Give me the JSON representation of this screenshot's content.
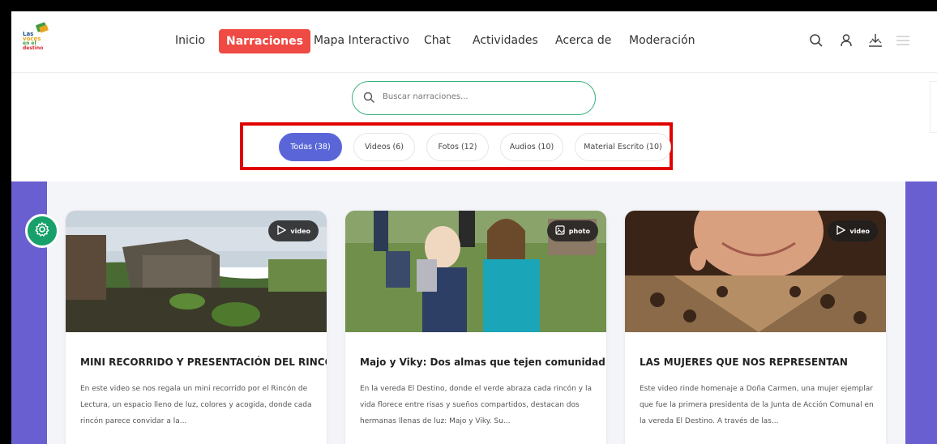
{
  "brand": {
    "logo_lines": [
      "Las",
      "voces",
      "en el",
      "destino"
    ]
  },
  "nav": {
    "items": [
      "Inicio",
      "Narraciones",
      "Mapa Interactivo",
      "Chat",
      "Actividades",
      "Acerca de",
      "Moderación"
    ],
    "active": "Narraciones"
  },
  "header_icons": [
    "search-icon",
    "user-icon",
    "download-icon",
    "menu-icon"
  ],
  "search": {
    "placeholder": "Buscar narraciones..."
  },
  "filters": {
    "tabs": [
      {
        "label": "Todas (38)",
        "active": true
      },
      {
        "label": "Videos (6)",
        "active": false
      },
      {
        "label": "Fotos (12)",
        "active": false
      },
      {
        "label": "Audios (10)",
        "active": false
      },
      {
        "label": "Material Escrito (10)",
        "active": false
      }
    ]
  },
  "cards": [
    {
      "badge": "video",
      "badge_icon": "play-icon",
      "title": "MINI RECORRIDO Y PRESENTACIÓN DEL RINCÓN",
      "description": "En este video se nos regala un mini recorrido por el Rincón de Lectura, un espacio lleno de luz, colores y acogida, donde cada rincón parece convidar a la..."
    },
    {
      "badge": "photo",
      "badge_icon": "image-icon",
      "title": "Majo y Viky: Dos almas que tejen comunidad",
      "description": "En la vereda El Destino, donde el verde abraza cada rincón y la vida florece entre risas y sueños compartidos, destacan dos hermanas llenas de luz: Majo y Viky. Su..."
    },
    {
      "badge": "video",
      "badge_icon": "play-icon",
      "title": "LAS MUJERES QUE NOS REPRESENTAN",
      "description": "Este video rinde homenaje a Doña Carmen, una mujer ejemplar que fue la primera presidenta de la Junta de Acción Comunal en la vereda El Destino. A través de las..."
    }
  ],
  "colors": {
    "accent_red": "#ef4a43",
    "pill_active": "#5a66d8",
    "band_purple": "#6a5fd0",
    "gear_green": "#18a06a",
    "search_border": "#3bb27a",
    "highlight_box": "#e00000"
  }
}
